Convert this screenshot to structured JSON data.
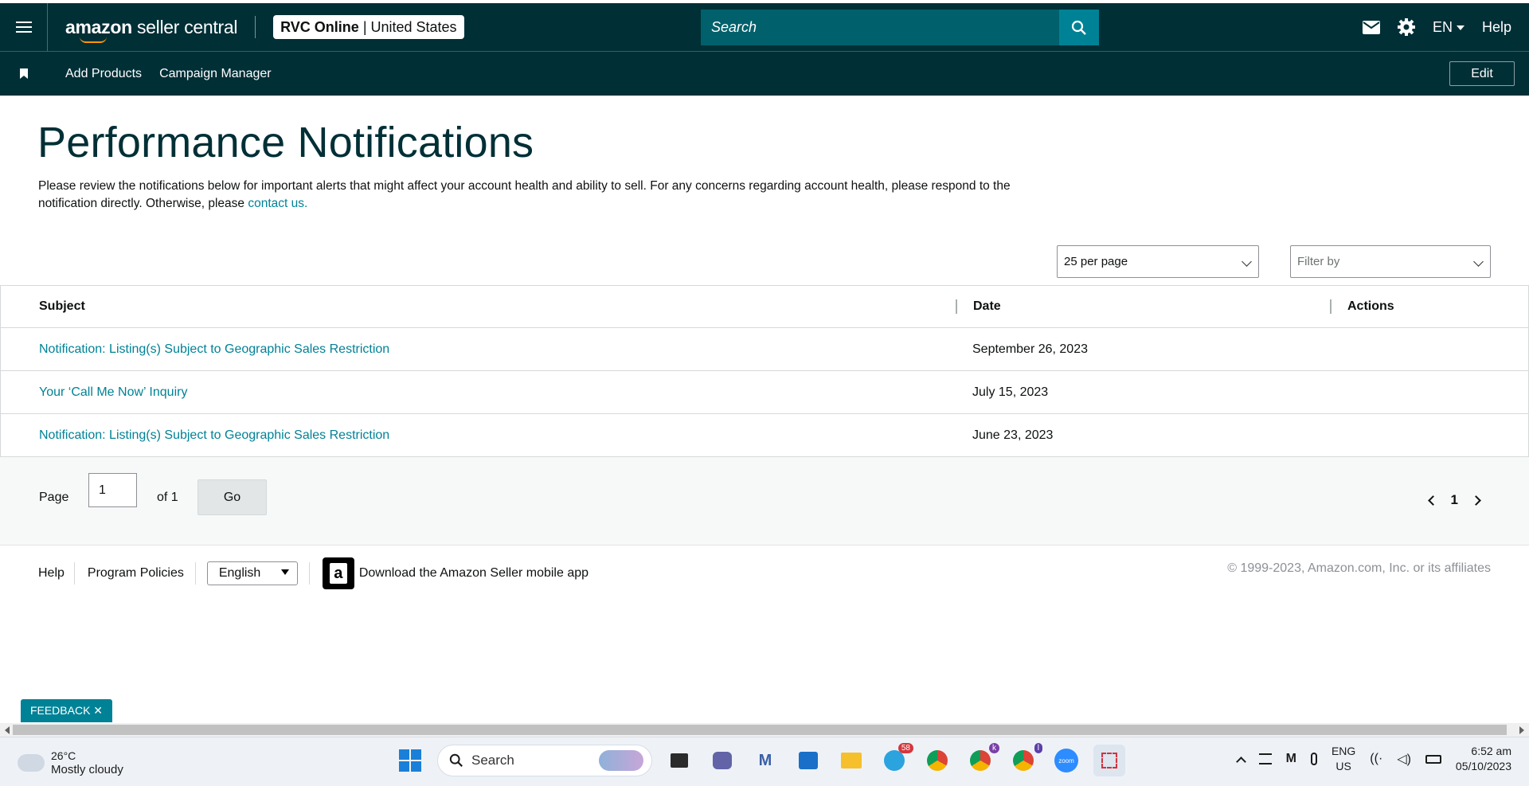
{
  "header": {
    "logo_main": "amazon",
    "logo_sub": "seller central",
    "store_name": "RVC Online",
    "store_sep": "|",
    "store_country": "United States",
    "search_placeholder": "Search",
    "language": "EN",
    "help": "Help"
  },
  "subnav": {
    "items": [
      "Add Products",
      "Campaign Manager"
    ],
    "edit": "Edit"
  },
  "page": {
    "title": "Performance Notifications",
    "intro_text": "Please review the notifications below for important alerts that might affect your account health and ability to sell. For any concerns regarding account health, please respond to the notification directly. Otherwise, please ",
    "intro_link": "contact us."
  },
  "controls": {
    "per_page": "25 per page",
    "filter_placeholder": "Filter by"
  },
  "table": {
    "headers": [
      "Subject",
      "Date",
      "Actions"
    ],
    "rows": [
      {
        "subject": "Notification: Listing(s) Subject to Geographic Sales Restriction",
        "date": "September 26, 2023",
        "actions": ""
      },
      {
        "subject": "Your ‘Call Me Now’ Inquiry",
        "date": "July 15, 2023",
        "actions": ""
      },
      {
        "subject": "Notification: Listing(s) Subject to Geographic Sales Restriction",
        "date": "June 23, 2023",
        "actions": ""
      }
    ]
  },
  "pager": {
    "page_label": "Page",
    "page_value": "1",
    "of_label": "of 1",
    "go": "Go",
    "current": "1"
  },
  "footer": {
    "help": "Help",
    "policies": "Program Policies",
    "language": "English",
    "app_icon_letter": "a",
    "app_text": "Download the Amazon Seller mobile app",
    "copyright": "© 1999-2023, Amazon.com, Inc. or its affiliates"
  },
  "feedback": "FEEDBACK ✕",
  "taskbar": {
    "temp": "26°C",
    "weather": "Mostly cloudy",
    "search": "Search",
    "telegram_badge": "58",
    "chrome_badge_1": "k",
    "chrome_badge_2": "l",
    "zoom": "zoom",
    "lang_top": "ENG",
    "lang_bottom": "US",
    "time": "6:52 am",
    "date": "05/10/2023"
  }
}
